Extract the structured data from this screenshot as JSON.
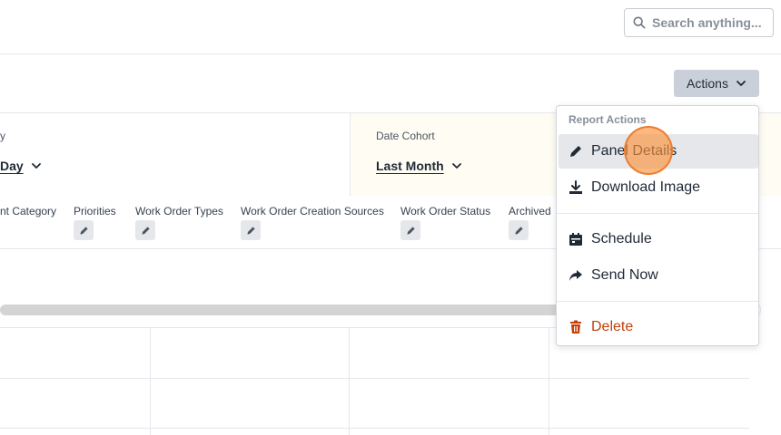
{
  "search": {
    "placeholder": "Search anything..."
  },
  "actions": {
    "label": "Actions"
  },
  "filters": {
    "left": {
      "label_fragment": "y",
      "value": "Day"
    },
    "right": {
      "label": "Date Cohort",
      "value": "Last Month"
    }
  },
  "columns": [
    {
      "label": "nt Category",
      "has_edit": false
    },
    {
      "label": "Priorities",
      "has_edit": true
    },
    {
      "label": "Work Order Types",
      "has_edit": true
    },
    {
      "label": "Work Order Creation Sources",
      "has_edit": true
    },
    {
      "label": "Work Order Status",
      "has_edit": true
    },
    {
      "label": "Archived",
      "has_edit": true
    }
  ],
  "menu": {
    "header": "Report Actions",
    "items": [
      {
        "label": "Panel Details",
        "icon": "pencil-icon"
      },
      {
        "label": "Download Image",
        "icon": "download-icon"
      },
      {
        "label": "Schedule",
        "icon": "calendar-icon"
      },
      {
        "label": "Send Now",
        "icon": "share-icon"
      },
      {
        "label": "Delete",
        "icon": "trash-icon"
      }
    ]
  },
  "colors": {
    "danger": "#c2410c",
    "actions_bg": "#c9d0d9",
    "highlight": "#fb923c"
  }
}
